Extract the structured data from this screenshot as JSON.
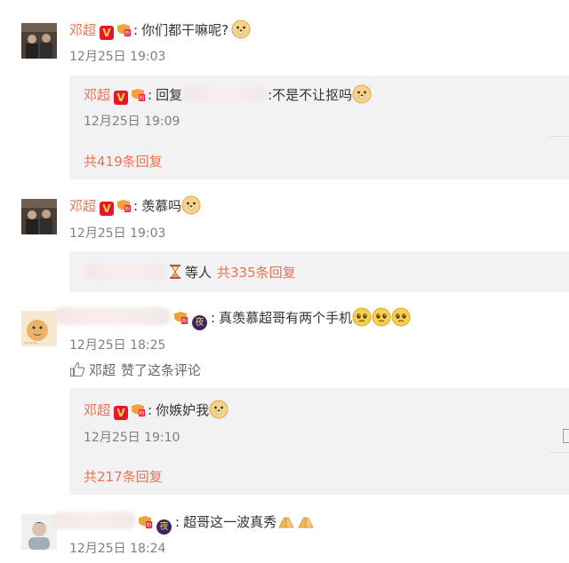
{
  "colors": {
    "accent": "#eb7350",
    "muted": "#808080",
    "reply_bg": "#f2f2f5"
  },
  "comments": [
    {
      "author": "邓超",
      "text": "你们都干嘛呢?",
      "time": "12月25日 19:03",
      "reply": {
        "author": "邓超",
        "prefix": "回复",
        "text": ":不是不让抠吗",
        "time": "12月25日 19:09"
      },
      "more_replies": "共419条回复"
    },
    {
      "author": "邓超",
      "text": "羡慕吗",
      "time": "12月25日 19:03",
      "summary": {
        "others": "等人",
        "more_replies": "共335条回复"
      }
    },
    {
      "text": "真羡慕超哥有两个手机",
      "time": "12月25日 18:25",
      "liked_by": "邓超",
      "liked_text": "赞了这条评论",
      "reply": {
        "author": "邓超",
        "text": "你嫉妒我",
        "time": "12月25日 19:10"
      },
      "more_replies": "共217条回复"
    },
    {
      "text": "超哥这一波真秀",
      "time": "12月25日 18:24"
    }
  ],
  "icons": [
    "verified-v-icon",
    "fan-medal-icon",
    "night-badge-icon",
    "doge-emoji",
    "thumbs-up-icon",
    "hourglass-icon",
    "pray-hands-emoji",
    "crying-emoji"
  ]
}
